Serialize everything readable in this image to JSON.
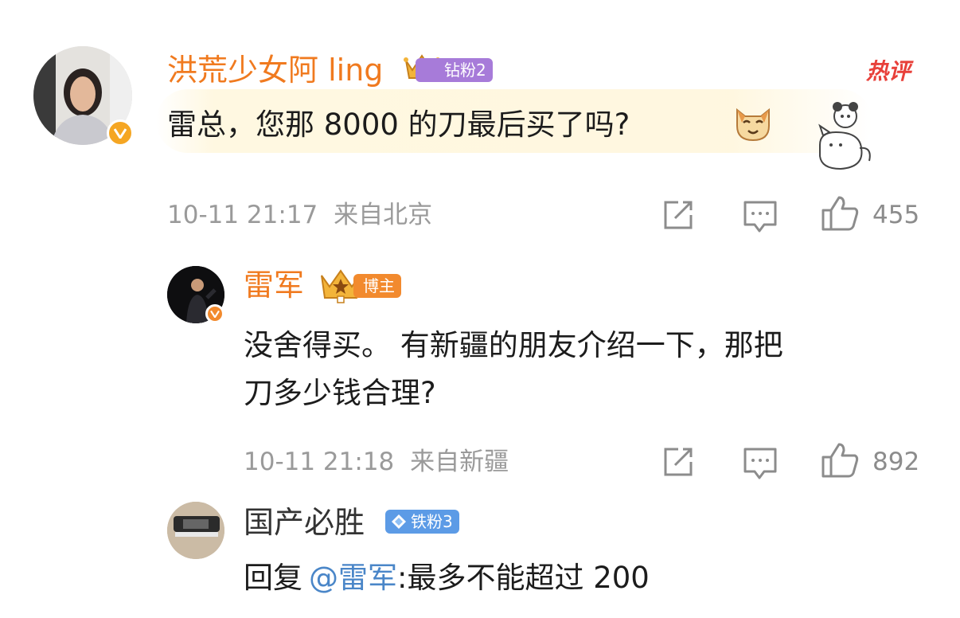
{
  "comments": [
    {
      "username": "洪荒少女阿 ling",
      "badge": "钻粉2",
      "hot_label": "热评",
      "text": "雷总，您那 8000 的刀最后买了吗?",
      "time": "10-11 21:17",
      "location": "来自北京",
      "likes": "455"
    },
    {
      "username": "雷军",
      "badge": "博主",
      "text_line1": "没舍得买。 有新疆的朋友介绍一下，那把",
      "text_line2": "刀多少钱合理?",
      "time": "10-11 21:18",
      "location": "来自新疆",
      "likes": "892"
    },
    {
      "username": "国产必胜",
      "badge": "铁粉3",
      "reply_prefix": "回复",
      "reply_mention": "@雷军",
      "reply_text": ":最多不能超过 200"
    }
  ],
  "colors": {
    "username_orange": "#f07a1f",
    "badge_purple": "#a77bd9",
    "badge_orange": "#f28a2e",
    "badge_blue": "#5c9be6",
    "hot_red": "#e8403a",
    "mention_blue": "#4a86c8",
    "meta_gray": "#9a9a9a"
  },
  "icons": [
    "verified-badge-icon",
    "crown-icon",
    "diamond-icon",
    "share-icon",
    "comment-icon",
    "thumbs-up-icon",
    "emoji-cat-icon"
  ]
}
